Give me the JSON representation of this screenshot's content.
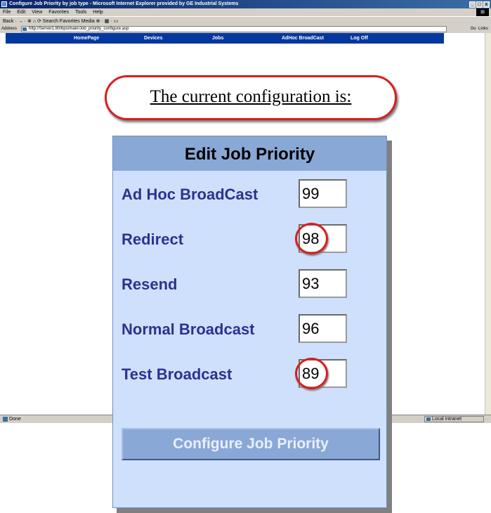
{
  "browser": {
    "title": "Configure Job Priority by job type - Microsoft Internet Explorer provided by GE Industrial Systems",
    "window_buttons": [
      "_",
      "□",
      "x"
    ],
    "menu": [
      "File",
      "Edit",
      "View",
      "Favorites",
      "Tools",
      "Help"
    ],
    "toolbar": "Back · → · ⊗ ⌂ ⟳  Search  Favorites  Media  ⊕ · ▦ · ▭",
    "address_label": "Address",
    "address_url": "http://Server1:80/bps/main/Job_priority_configure.asp",
    "go_label": "Go",
    "links_label": "Links",
    "status_left": "Done",
    "status_zone": "Local intranet",
    "logo": "⊞"
  },
  "nav": {
    "items": [
      "HomePage",
      "Devices",
      "Jobs",
      "AdHoc BroadCast",
      "Log Off"
    ]
  },
  "heading": "The current configuration is:",
  "dialog": {
    "title": "Edit Job Priority",
    "rows": [
      {
        "label": "Ad Hoc BroadCast",
        "value": "99"
      },
      {
        "label": "Redirect",
        "value": "98"
      },
      {
        "label": "Resend",
        "value": "93"
      },
      {
        "label": "Normal Broadcast",
        "value": "96"
      },
      {
        "label": "Test Broadcast",
        "value": "89"
      }
    ],
    "button_label": "Configure Job Priority"
  }
}
